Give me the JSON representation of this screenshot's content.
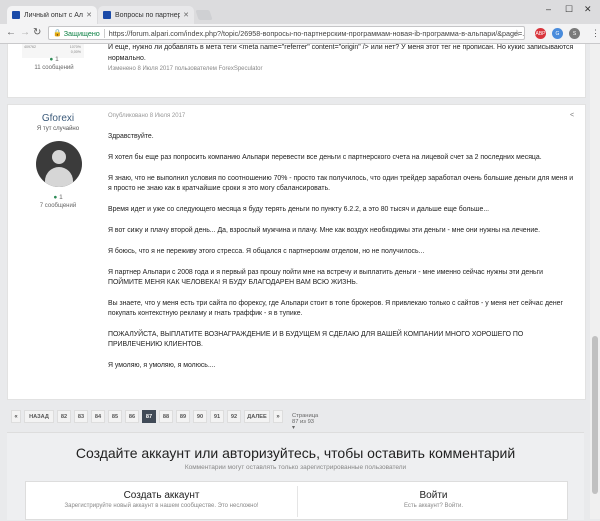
{
  "browser": {
    "tabs": [
      {
        "title": "Личный опыт с Альпар",
        "favicon_color": "#1a4aa8"
      },
      {
        "title": "Вопросы по партнерск",
        "favicon_color": "#1a4aa8"
      }
    ],
    "address": {
      "secure_label": "Защищено",
      "url": "https://forum.alpari.com/index.php?/topic/26958-вопросы-по-партнерским-программам-новая-ib-программа-в-альпари/&page=..."
    },
    "extensions": [
      "ABP",
      "G",
      "S"
    ]
  },
  "post1": {
    "mini_stats_left": "409762",
    "mini_stats_right_1": "1070%",
    "mini_stats_right_2": "0,00%",
    "reputation": "1",
    "count": "11 сообщений",
    "text": "И еще, нужно ли добавлять в мета теги <meta name=\"referrer\" content=\"origin\" /> или нет? У меня этот тег не прописан. Но кукис записываются нормально.",
    "edited": "Изменено 8 Июля 2017 пользователем ForexSpeculator"
  },
  "post2": {
    "author": "Gforexi",
    "title": "Я тут случайно",
    "reputation": "1",
    "count": "7 сообщений",
    "published": "Опубликовано 8 Июля 2017",
    "paragraphs": [
      "Здравствуйте.",
      "Я хотел бы еще раз попросить компанию Альпари перевести все деньги с партнерского счета на лицевой счет за 2 последних месяца.",
      "Я знаю, что не выполнил условия по соотношению 70% - просто так получилось, что один трейдер заработал очень большие деньги для меня и я просто не знаю как в кратчайшие сроки я это могу сбалансировать.",
      "Время идет и уже со следующего месяца я буду терять деньги по пункту 6.2.2, а это 80 тысяч и дальше еще больше...",
      "Я вот сижу и плачу второй день... Да, взрослый мужчина и плачу. Мне как воздух необходимы эти деньги - мне они нужны на лечение.",
      "Я боюсь, что я не переживу этого стресса. Я общался с партнерским отделом, но не получилось...",
      "Я партнер Альпари с 2008 года и я первый раз прошу пойти мне на встречу и выплатить деньги - мне именно сейчас нужны эти деньги ПОЙМИТЕ МЕНЯ КАК ЧЕЛОВЕКА! Я БУДУ БЛАГОДАРЕН ВАМ ВСЮ ЖИЗНЬ.",
      "Вы знаете, что у меня есть три сайта по форексу, где Альпари стоит в топе брокеров. Я привлекаю только с сайтов - у меня нет сейчас денег покупать контекстную рекламу и гнать траффик - я в тупике.",
      "ПОЖАЛУЙСТА, ВЫПЛАТИТЕ ВОЗНАГРАЖДЕНИЕ И В БУДУЩЕМ Я СДЕЛАЮ ДЛЯ ВАШЕЙ КОМПАНИИ МНОГО ХОРОШЕГО ПО ПРИВЛЕЧЕНИЮ КЛИЕНТОВ.",
      "Я умоляю, я умоляю, я молюсь...."
    ]
  },
  "pagination": {
    "prev": "НАЗАД",
    "next": "ДАЛЕЕ",
    "pages": [
      "82",
      "83",
      "84",
      "85",
      "86",
      "87",
      "88",
      "89",
      "90",
      "91",
      "92"
    ],
    "current": "87",
    "info": "Страница 87 из 93"
  },
  "cta": {
    "title": "Создайте аккаунт или авторизуйтесь, чтобы оставить комментарий",
    "subtitle": "Комментарии могут оставлять только зарегистрированные пользователи",
    "register_title": "Создать аккаунт",
    "register_desc": "Зарегистрируйте новый аккаунт в нашем сообществе. Это несложно!",
    "login_title": "Войти",
    "login_desc": "Есть аккаунт? Войти."
  }
}
